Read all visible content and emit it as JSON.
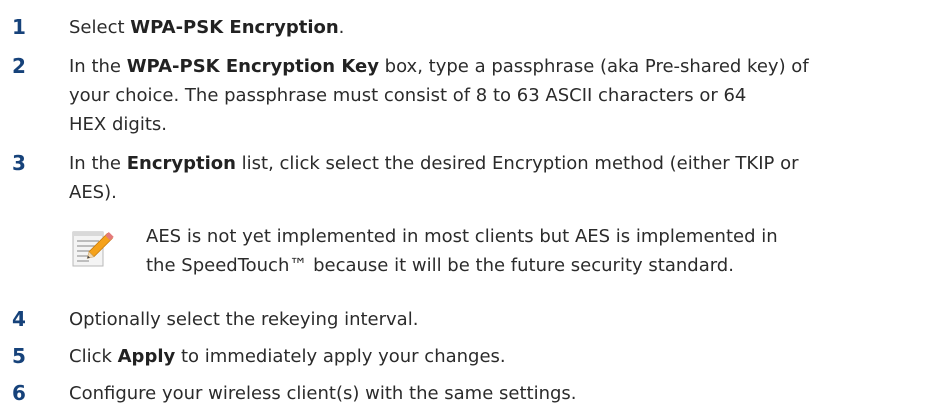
{
  "steps": [
    {
      "number": "1",
      "parts": {
        "a": "Select ",
        "b": "WPA-PSK Encryption",
        "c": "."
      }
    },
    {
      "number": "2",
      "parts": {
        "a": "In the ",
        "b": "WPA-PSK Encryption Key",
        "c": " box, type a passphrase (aka Pre-shared key) of",
        "d": "your choice. The passphrase must consist of 8 to 63 ASCII characters or 64",
        "e": "HEX digits."
      }
    },
    {
      "number": "3",
      "parts": {
        "a": "In the ",
        "b": "Encryption",
        "c": " list, click select the desired Encryption method (either TKIP or",
        "d": "AES)."
      }
    },
    {
      "number": "4",
      "parts": {
        "a": "Optionally select the rekeying interval."
      }
    },
    {
      "number": "5",
      "parts": {
        "a": "Click ",
        "b": "Apply",
        "c": " to immediately apply your changes."
      }
    },
    {
      "number": "6",
      "parts": {
        "a": "Configure your wireless client(s) with the same settings."
      }
    }
  ],
  "note": {
    "icon": "note-pencil-icon",
    "line1": "AES is not yet implemented in most clients but AES is implemented in",
    "line2": "the SpeedTouch™ because it will be the future security standard."
  },
  "colors": {
    "step_number": "#16427a",
    "body_text": "#2b2b2b"
  }
}
